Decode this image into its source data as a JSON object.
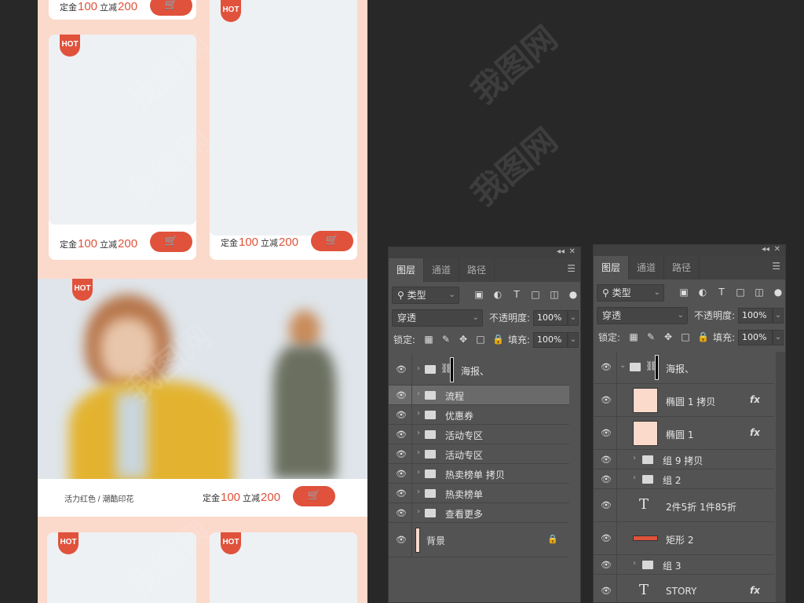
{
  "canvas": {
    "hot_label": "HOT",
    "price_prefix": "定金",
    "price_deposit": "100",
    "price_discount_label": "立减",
    "price_discount": "200",
    "cart_icon": "cart-icon",
    "hero_caption": "活力红色 / 潮酷印花"
  },
  "watermark": "我图网",
  "left_panel": {
    "tabs": [
      "图层",
      "通道",
      "路径"
    ],
    "filter_type": "类型",
    "blend_mode": "穿透",
    "opacity_label": "不透明度:",
    "opacity_value": "100%",
    "lock_label": "锁定:",
    "fill_label": "填充:",
    "fill_value": "100%",
    "layers": [
      {
        "name": "海报、",
        "kind": "group-link"
      },
      {
        "name": "流程",
        "kind": "group"
      },
      {
        "name": "优惠券",
        "kind": "group"
      },
      {
        "name": "活动专区",
        "kind": "group"
      },
      {
        "name": "活动专区",
        "kind": "group"
      },
      {
        "name": "热卖榜单 拷贝",
        "kind": "group"
      },
      {
        "name": "热卖榜单",
        "kind": "group"
      },
      {
        "name": "查看更多",
        "kind": "group"
      },
      {
        "name": "背景",
        "kind": "background"
      }
    ]
  },
  "right_panel": {
    "tabs": [
      "图层",
      "通道",
      "路径"
    ],
    "filter_type": "类型",
    "blend_mode": "穿透",
    "opacity_label": "不透明度:",
    "opacity_value": "100%",
    "lock_label": "锁定:",
    "fill_label": "填充:",
    "fill_value": "100%",
    "fx_label": "fx",
    "text_glyph": "T",
    "layers": [
      {
        "name": "海报、",
        "kind": "group-open"
      },
      {
        "name": "椭圆 1 拷贝",
        "kind": "shape-fx"
      },
      {
        "name": "椭圆 1",
        "kind": "shape-fx"
      },
      {
        "name": "组 9 拷贝",
        "kind": "group"
      },
      {
        "name": "组 2",
        "kind": "group"
      },
      {
        "name": "2件5折 1件85折",
        "kind": "text"
      },
      {
        "name": "矩形 2",
        "kind": "rect"
      },
      {
        "name": "组 3",
        "kind": "group"
      },
      {
        "name": "STORY",
        "kind": "text-fx"
      }
    ]
  },
  "colors": {
    "accent": "#e0523b",
    "canvas_bg": "#fbd9cb",
    "app_bg": "#282828",
    "panel_bg": "#535353"
  }
}
